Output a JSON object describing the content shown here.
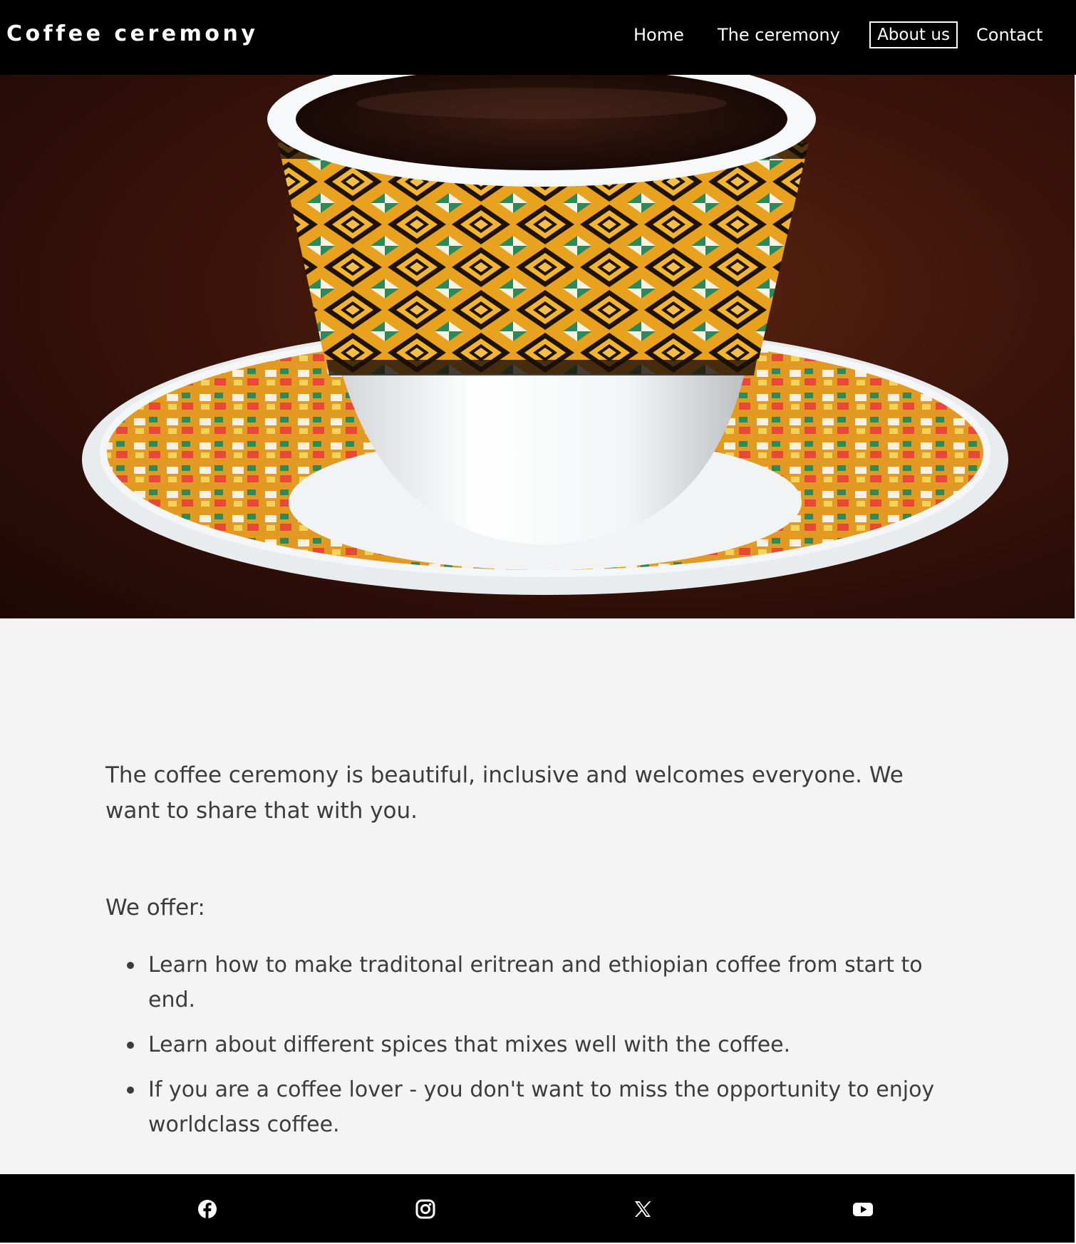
{
  "header": {
    "brand": "Coffee ceremony",
    "nav": {
      "home": "Home",
      "ceremony": "The ceremony",
      "about": "About us",
      "contact": "Contact"
    },
    "active_nav": "About us"
  },
  "hero": {
    "image_icon": "coffee-cup-photo"
  },
  "main": {
    "intro": "The coffee ceremony is beautiful, inclusive and welcomes everyone. We want to share that with you.",
    "offer_title": "We offer:",
    "offers": [
      "Learn how to make traditonal eritrean and ethiopian coffee from start to end.",
      "Learn about different spices that mixes well with the coffee.",
      "If you are a coffee lover - you don't want to miss the opportunity to enjoy worldclass coffee."
    ]
  },
  "footer": {
    "social_icons": [
      "facebook-icon",
      "instagram-icon",
      "x-icon",
      "youtube-icon"
    ]
  },
  "colors": {
    "header_bg": "#000000",
    "page_bg": "#f4f4f4",
    "text": "#3c3c3c",
    "accent": "#ffffff"
  }
}
